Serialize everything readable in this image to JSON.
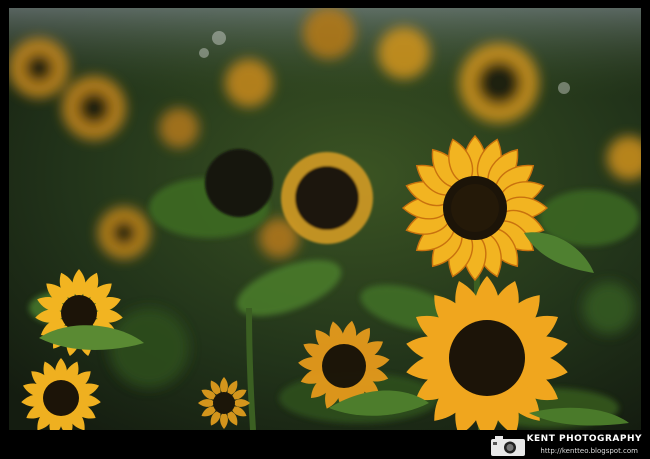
{
  "watermark": {
    "brand": "KENT PHOTOGRAPHY",
    "url": "http://kentteo.blogspot.com",
    "icon": "camera-icon"
  },
  "colors": {
    "petal": "#f2b421",
    "petal_dark": "#d07a10",
    "center": "#1c1408",
    "leaf": "#3f6a24",
    "background": "#1d2a14",
    "frame": "#000000"
  }
}
